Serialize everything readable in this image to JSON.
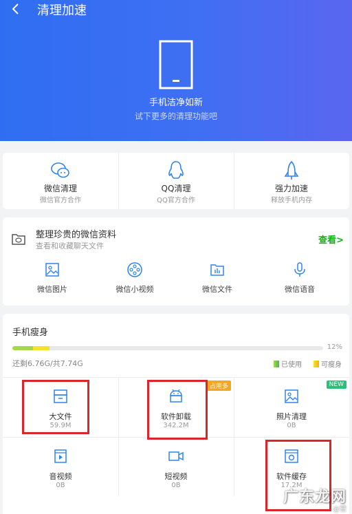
{
  "header": {
    "title": "清理加速",
    "hero_title": "手机洁净如新",
    "hero_subtitle": "试下更多的清理功能吧"
  },
  "quick_actions": [
    {
      "label": "微信清理",
      "sub": "微信官方合作",
      "icon": "wechat-icon"
    },
    {
      "label": "QQ清理",
      "sub": "QQ官方合作",
      "icon": "qq-penguin-icon"
    },
    {
      "label": "强力加速",
      "sub": "释放手机内存",
      "icon": "rocket-icon"
    }
  ],
  "wechat_card": {
    "title": "整理珍贵的微信资料",
    "subtitle": "查看和收藏聊天文件",
    "link": "查看>",
    "items": [
      {
        "label": "微信图片",
        "icon": "image-icon"
      },
      {
        "label": "微信小视频",
        "icon": "film-reel-icon"
      },
      {
        "label": "微信文件",
        "icon": "file-chart-icon"
      },
      {
        "label": "微信语音",
        "icon": "microphone-icon"
      }
    ]
  },
  "slim": {
    "title": "手机瘦身",
    "used_fraction": 0.12,
    "percent_label": "12%",
    "storage_text": "还剩6.76G/共7.74G",
    "legend_used": "已使用",
    "legend_slim": "可瘦身",
    "colors": {
      "used": "#a6d94a",
      "slimmable": "#f5e32b"
    },
    "tiles": [
      {
        "label": "大文件",
        "sub": "59.9M",
        "icon": "drawer-icon"
      },
      {
        "label": "软件卸载",
        "sub": "342.2M",
        "icon": "android-icon",
        "badge": "占用多"
      },
      {
        "label": "照片清理",
        "sub": "0B",
        "icon": "photo-icon",
        "badge": "NEW"
      },
      {
        "label": "音视频",
        "sub": "0B",
        "icon": "media-play-icon"
      },
      {
        "label": "短视频",
        "sub": "0B",
        "icon": "video-camera-icon"
      },
      {
        "label": "软件缓存",
        "sub": "17.2M",
        "icon": "cache-icon"
      }
    ]
  },
  "watermark": {
    "text": "广东龙网",
    "sub": "@营"
  }
}
